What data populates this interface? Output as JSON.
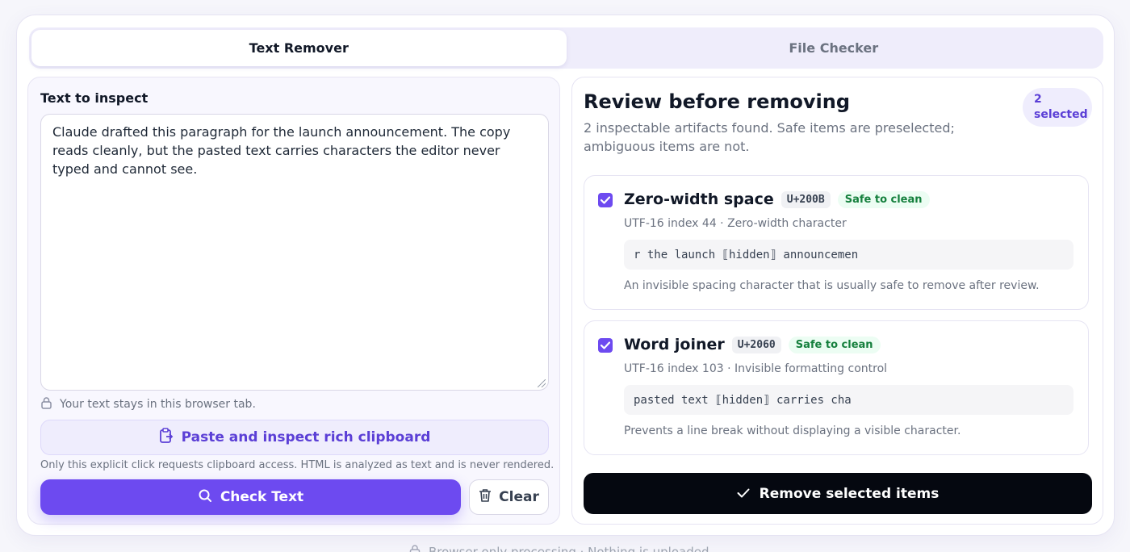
{
  "tabs": [
    {
      "label": "Text Remover",
      "active": true
    },
    {
      "label": "File Checker",
      "active": false
    }
  ],
  "input_panel": {
    "label": "Text to inspect",
    "text": "Claude drafted this paragraph for the launch announcement. The copy reads cleanly, but the pasted text carries characters the editor never typed and cannot see.",
    "privacy_note": "Your text stays in this browser tab.",
    "paste_button": "Paste and inspect rich clipboard",
    "clipboard_note": "Only this explicit click requests clipboard access. HTML is analyzed as text and is never rendered.",
    "check_button": "Check Text",
    "clear_button": "Clear"
  },
  "review": {
    "title": "Review before removing",
    "subtitle": "2 inspectable artifacts found. Safe items are preselected; ambiguous items are not.",
    "selected_count": "2",
    "selected_label": "selected",
    "items": [
      {
        "name": "Zero-width space",
        "code": "U+200B",
        "badge": "Safe to clean",
        "meta": "UTF-16 index 44 · Zero-width character",
        "context": "r the launch ⟦hidden⟧ announcemen",
        "description": "An invisible spacing character that is usually safe to remove after review.",
        "checked": true
      },
      {
        "name": "Word joiner",
        "code": "U+2060",
        "badge": "Safe to clean",
        "meta": "UTF-16 index 103 · Invisible formatting control",
        "context": "pasted text ⟦hidden⟧ carries cha",
        "description": "Prevents a line break without displaying a visible character.",
        "checked": true
      }
    ],
    "remove_button": "Remove selected items"
  },
  "footer": {
    "text": "Browser-only processing · Nothing is uploaded"
  },
  "colors": {
    "accent": "#6d4af0",
    "accent_text": "#5b3fd6",
    "safe_text": "#15803d",
    "primary_dark": "#050810"
  }
}
